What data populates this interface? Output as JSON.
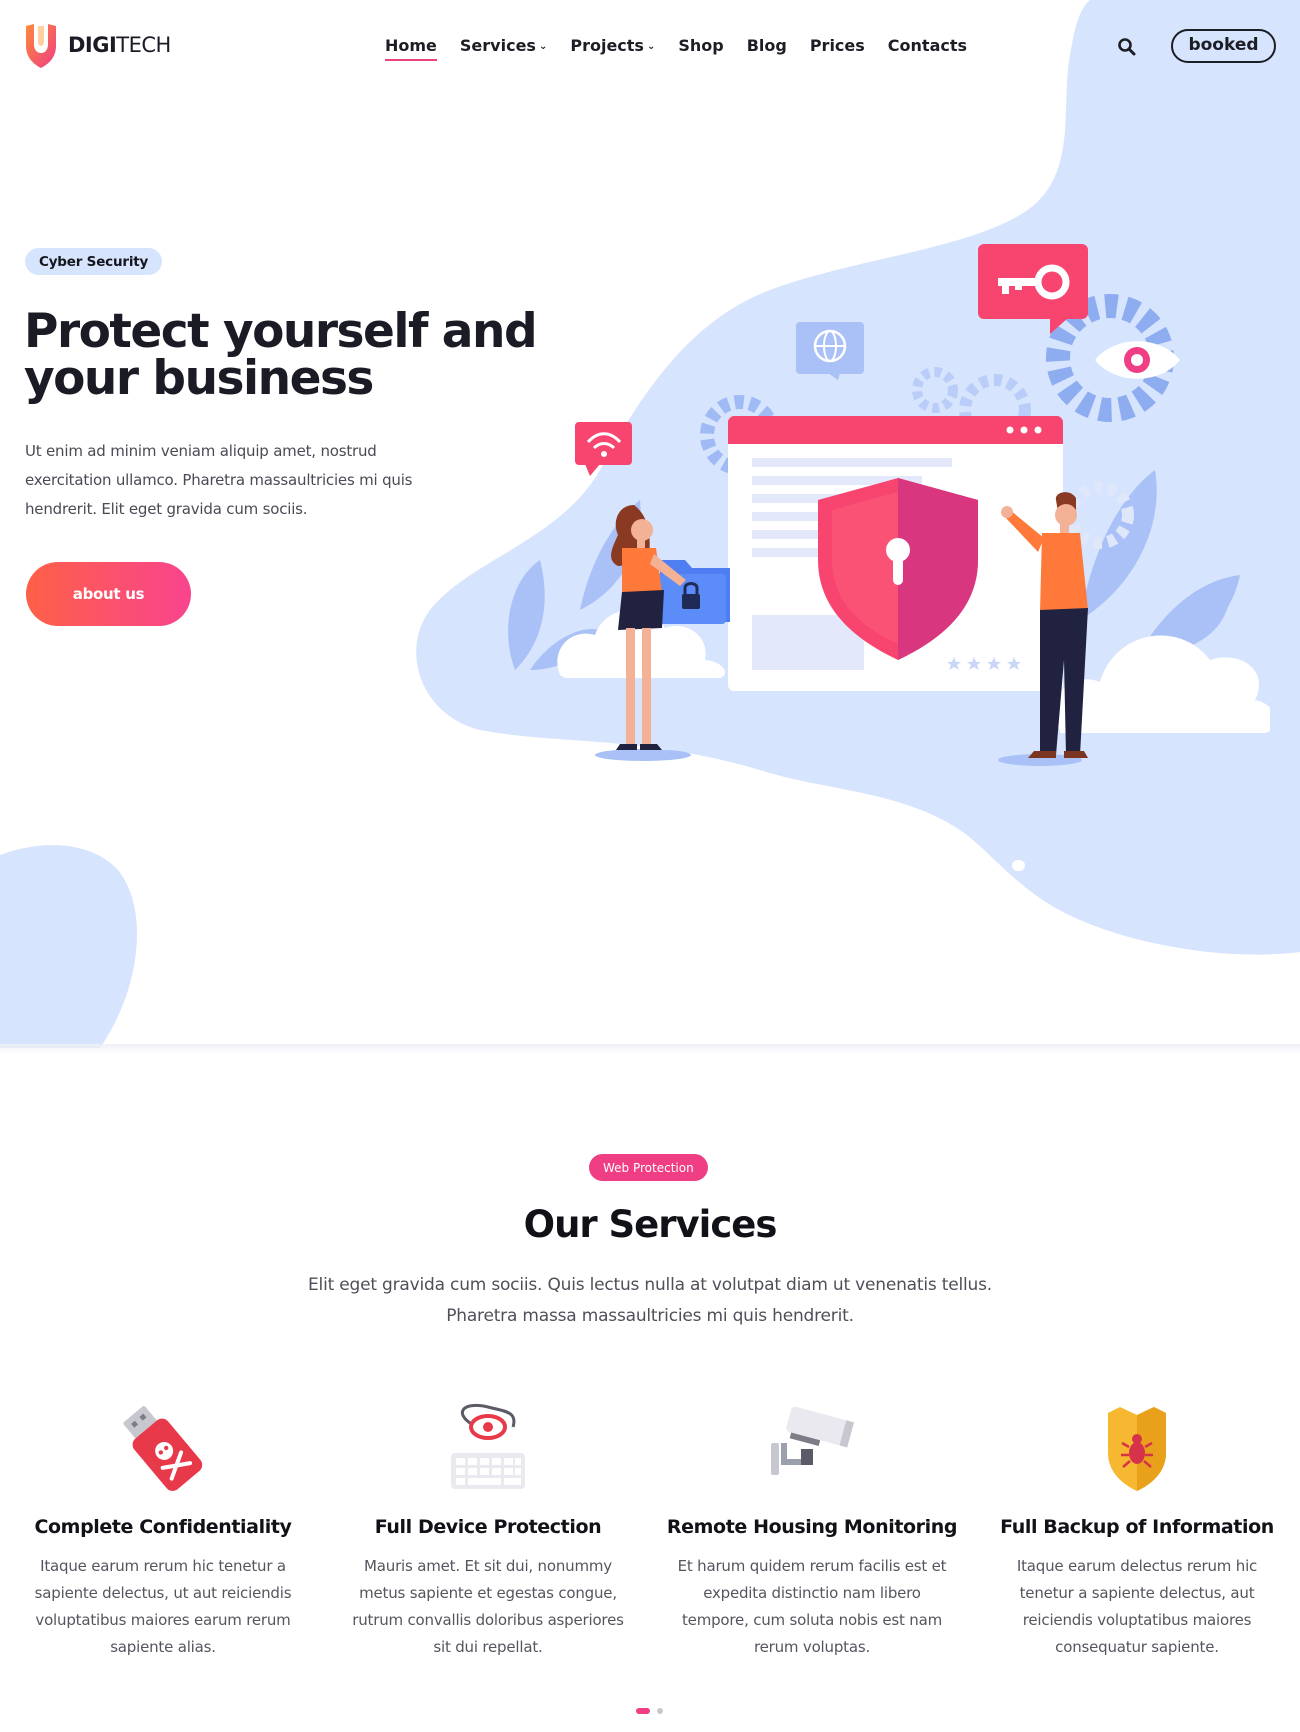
{
  "header": {
    "logo": {
      "bold": "DIGI",
      "light": "TECH"
    },
    "nav": [
      {
        "label": "Home",
        "has_dropdown": false,
        "active": true
      },
      {
        "label": "Services",
        "has_dropdown": true
      },
      {
        "label": "Projects",
        "has_dropdown": true
      },
      {
        "label": "Shop",
        "has_dropdown": false
      },
      {
        "label": "Blog",
        "has_dropdown": false
      },
      {
        "label": "Prices",
        "has_dropdown": false
      },
      {
        "label": "Contacts",
        "has_dropdown": false
      }
    ],
    "search_icon": "search-icon",
    "cta_label": "booked"
  },
  "hero": {
    "badge": "Cyber Security",
    "title_line1": "Protect yourself and",
    "title_line2": "your business",
    "text": "Ut enim ad minim veniam aliquip amet, nostrud exercitation ullamco. Pharetra massaultricies mi quis hendrerit. Elit eget gravida cum sociis.",
    "button_label": "about us",
    "slider_dots": 1
  },
  "services": {
    "badge": "Web Protection",
    "title": "Our Services",
    "intro_line1": "Elit eget gravida cum sociis. Quis lectus nulla at volutpat diam ut venenatis tellus.",
    "intro_line2": "Pharetra massa massaultricies mi quis hendrerit.",
    "cards": [
      {
        "icon": "usb-virus-icon",
        "title": "Complete Confidentiality",
        "text": "Itaque earum rerum hic tenetur a sapiente delectus, ut aut reiciendis voluptatibus maiores earum rerum sapiente alias."
      },
      {
        "icon": "keyboard-eye-icon",
        "title": "Full Device Protection",
        "text": "Mauris amet. Et sit dui, nonummy metus sapiente et egestas congue, rutrum convallis doloribus asperiores sit dui repellat."
      },
      {
        "icon": "security-camera-icon",
        "title": "Remote Housing Monitoring",
        "text": "Et harum quidem rerum facilis est et expedita distinctio nam libero tempore, cum soluta nobis est nam rerum voluptas."
      },
      {
        "icon": "bug-shield-icon",
        "title": "Full Backup of Information",
        "text": "Itaque earum delectus rerum hic tenetur a sapiente delectus, aut reiciendis voluptatibus maiores consequatur sapiente."
      }
    ],
    "pager": {
      "pages": 2,
      "active": 1
    }
  },
  "colors": {
    "accent_pink": "#ef3e83",
    "gradient_start": "#fd6047",
    "gradient_end": "#f9448e",
    "blob_blue": "#d6e4fd",
    "text_dark": "#1b1b25"
  }
}
